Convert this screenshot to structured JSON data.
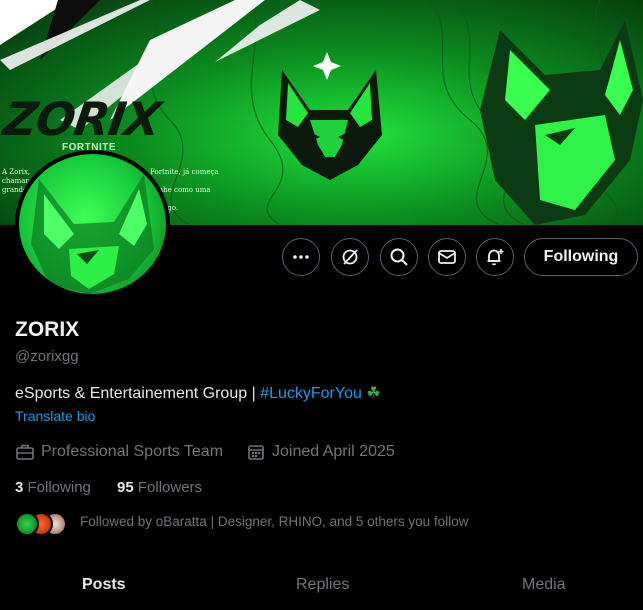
{
  "banner": {
    "title": "ZORIX",
    "subtitle": "FORTNITE",
    "blurb_left": "A Zorix, ... Fortnite, já começa a chamar ... ganhe como uma das grandes ... do jogo."
  },
  "profile": {
    "name": "ZORIX",
    "handle": "@zorixgg",
    "bio_text": "eSports & Entertainement Group | ",
    "bio_hashtag": "#LuckyForYou",
    "bio_emoji": "☘",
    "translate_label": "Translate bio",
    "category": "Professional Sports Team",
    "joined": "Joined April 2025"
  },
  "stats": {
    "following_count": "3",
    "following_label": "Following",
    "followers_count": "95",
    "followers_label": "Followers"
  },
  "followed_by": {
    "text": "Followed by oBaratta | Designer, RHINO, and 5 others you follow"
  },
  "actions": {
    "follow_label": "Following",
    "icons": [
      "more-icon",
      "grok-icon",
      "search-icon",
      "message-icon",
      "notification-bell-icon"
    ]
  },
  "tabs": [
    {
      "label": "Posts",
      "active": true
    },
    {
      "label": "Replies",
      "active": false
    },
    {
      "label": "Media",
      "active": false
    }
  ],
  "colors": {
    "accent": "#1d9bf0",
    "brand_green": "#17e03a",
    "border": "#536471",
    "muted": "#71767b"
  }
}
